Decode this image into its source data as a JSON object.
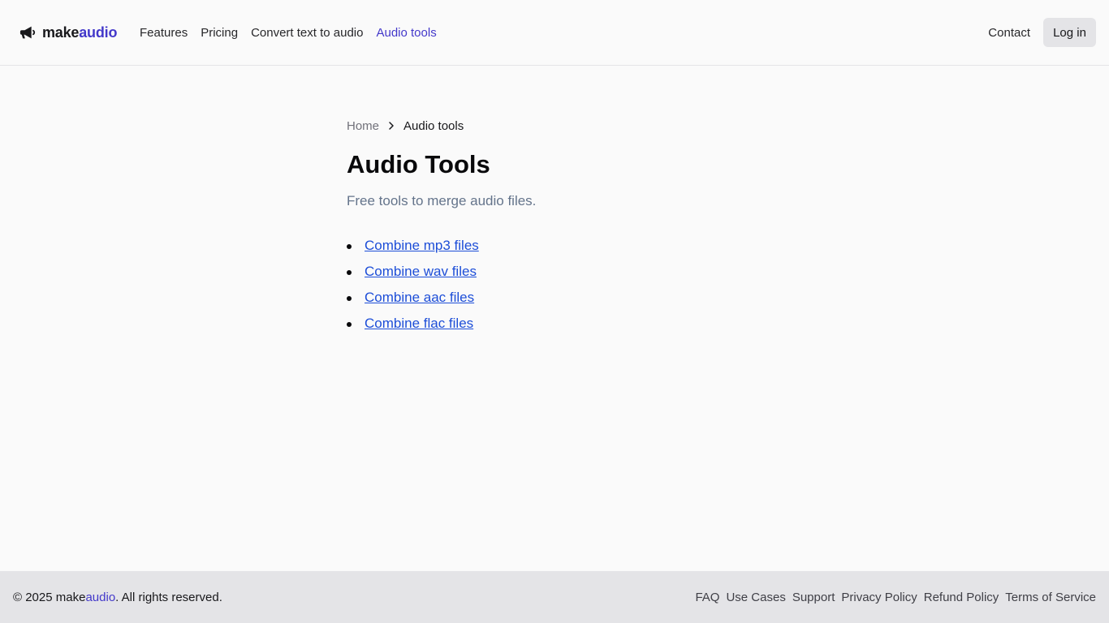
{
  "header": {
    "logo": {
      "text_main": "make",
      "text_accent": "audio",
      "icon": "megaphone-icon"
    },
    "nav": [
      {
        "label": "Features",
        "active": false
      },
      {
        "label": "Pricing",
        "active": false
      },
      {
        "label": "Convert text to audio",
        "active": false
      },
      {
        "label": "Audio tools",
        "active": true
      }
    ],
    "contact_label": "Contact",
    "login_label": "Log in"
  },
  "breadcrumb": {
    "home": "Home",
    "separator_icon": "chevron-right-icon",
    "current": "Audio tools"
  },
  "main": {
    "title": "Audio Tools",
    "subtitle": "Free tools to merge audio files.",
    "tools": [
      {
        "label": "Combine mp3 files"
      },
      {
        "label": "Combine wav files"
      },
      {
        "label": "Combine aac files"
      },
      {
        "label": "Combine flac files"
      }
    ]
  },
  "footer": {
    "copyright_prefix": "© 2025 ",
    "brand_main": "make",
    "brand_accent": "audio",
    "copyright_suffix": ". All rights reserved.",
    "links": [
      {
        "label": "FAQ"
      },
      {
        "label": "Use Cases"
      },
      {
        "label": "Support"
      },
      {
        "label": "Privacy Policy"
      },
      {
        "label": "Refund Policy"
      },
      {
        "label": "Terms of Service"
      }
    ]
  },
  "colors": {
    "accent": "#4338ca",
    "link": "#1d4ed8",
    "background": "#fafafa",
    "footer_bg": "#e4e4e7",
    "muted_text": "#64748b"
  }
}
